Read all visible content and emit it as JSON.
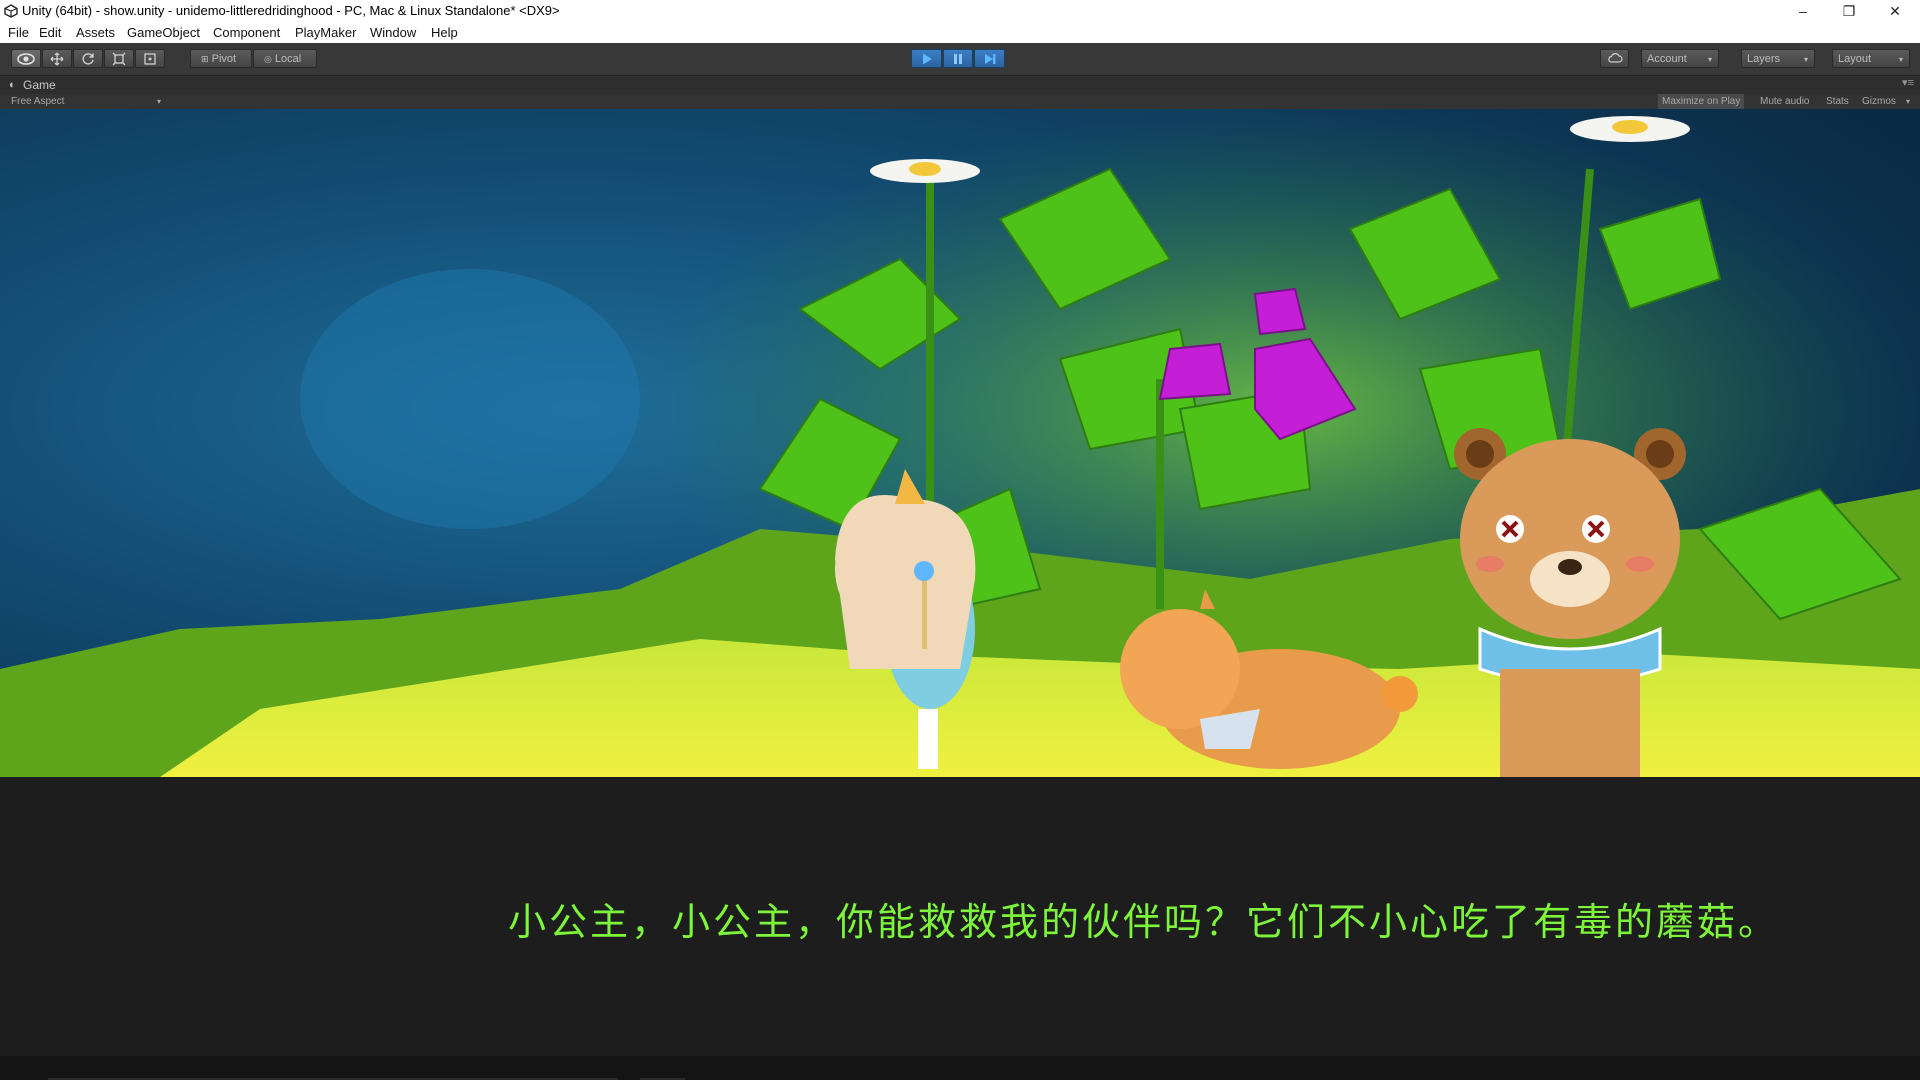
{
  "window": {
    "title": "Unity (64bit) - show.unity - unidemo-littleredridinghood - PC, Mac & Linux Standalone* <DX9>",
    "minimize_glyph": "–",
    "restore_glyph": "❐",
    "close_glyph": "✕"
  },
  "menubar": {
    "items": [
      "File",
      "Edit",
      "Assets",
      "GameObject",
      "Component",
      "PlayMaker",
      "Window",
      "Help"
    ]
  },
  "toolbar": {
    "tools": [
      "view-tool",
      "move-tool",
      "rotate-tool",
      "scale-tool",
      "rect-tool"
    ],
    "pivot_label": "Pivot",
    "local_label": "Local",
    "play_icons": [
      "play-icon",
      "pause-icon",
      "step-icon"
    ],
    "account_label": "Account",
    "layers_label": "Layers",
    "layout_label": "Layout"
  },
  "game_tab": {
    "label": "Game",
    "aspect": "Free Aspect",
    "maximize_on_play": "Maximize on Play",
    "mute_audio": "Mute audio",
    "stats": "Stats",
    "gizmos": "Gizmos"
  },
  "dialogue": {
    "text": "小公主，小公主，你能救救我的伙伴吗？它们不小心吃了有毒的蘑菇。",
    "color": "#7cf53a"
  },
  "colors": {
    "toolbar_bg": "#383838",
    "play_accent": "#3b7fc4",
    "dialogue_bg": "#1d1d1d"
  }
}
